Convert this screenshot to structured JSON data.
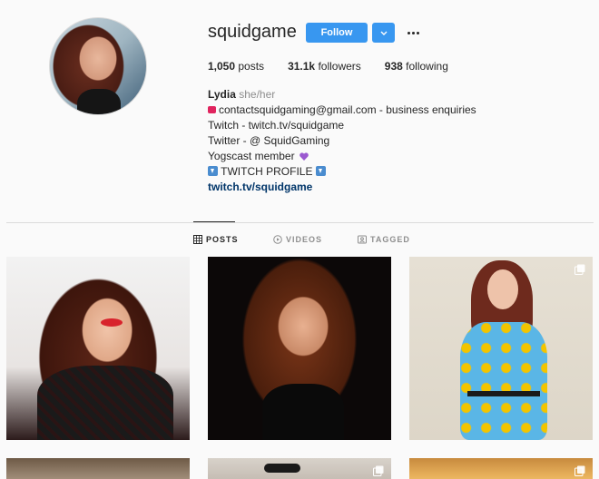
{
  "profile": {
    "username": "squidgame",
    "follow_label": "Follow",
    "stats": {
      "posts_count": "1,050",
      "posts_label": "posts",
      "followers_count": "31.1k",
      "followers_label": "followers",
      "following_count": "938",
      "following_label": "following"
    },
    "bio": {
      "name": "Lydia",
      "pronouns": "she/her",
      "line1": "contactsquidgaming@gmail.com - business enquiries",
      "line2": "Twitch - twitch.tv/squidgame",
      "line3": "Twitter - @ SquidGaming",
      "line4": "Yogscast member",
      "line5": "TWITCH PROFILE",
      "link": "twitch.tv/squidgame"
    }
  },
  "tabs": [
    {
      "label": "POSTS",
      "icon": "grid-icon",
      "active": true
    },
    {
      "label": "VIDEOS",
      "icon": "play-circle-icon",
      "active": false
    },
    {
      "label": "TAGGED",
      "icon": "tag-portrait-icon",
      "active": false
    }
  ],
  "colors": {
    "accent": "#3897f0",
    "link": "#003569",
    "muted": "#8e8e8e"
  }
}
